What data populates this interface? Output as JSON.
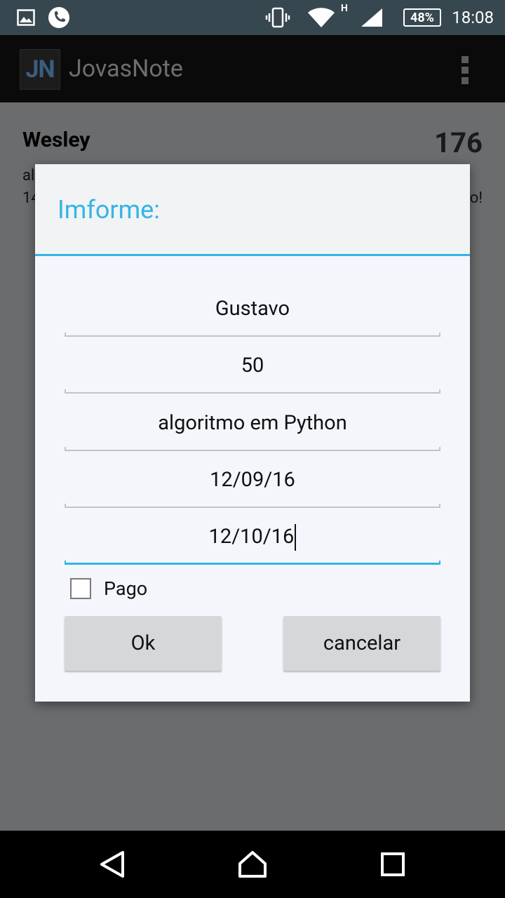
{
  "status_bar": {
    "time": "18:08",
    "battery_text": "48%",
    "network_type": "H",
    "icons": [
      "image-icon",
      "phone-icon",
      "vibrate-icon",
      "wifi-icon",
      "signal-icon",
      "battery-icon"
    ]
  },
  "action_bar": {
    "logo_text": "JN",
    "title": "JovasNote",
    "menu_icon": "overflow-menu-icon"
  },
  "background_list": {
    "name": "Wesley",
    "count": "176",
    "line1_partial": "al",
    "line2_partial": "14",
    "line2_right_partial": "o!"
  },
  "dialog": {
    "title": "Imforme:",
    "fields": [
      {
        "value": "Gustavo"
      },
      {
        "value": "50"
      },
      {
        "value": "algoritmo em Python"
      },
      {
        "value": "12/09/16"
      },
      {
        "value": "12/10/16"
      }
    ],
    "checkbox_label": "Pago",
    "checkbox_checked": false,
    "ok_label": "Ok",
    "cancel_label": "cancelar"
  },
  "colors": {
    "accent": "#33b5e5",
    "statusbar": "#37474f",
    "actionbar": "#0a0a0a",
    "dim_background": "#6b6c6e",
    "button": "#d6d7d9"
  },
  "nav_bar": {
    "icons": [
      "back-icon",
      "home-icon",
      "recents-icon"
    ]
  }
}
